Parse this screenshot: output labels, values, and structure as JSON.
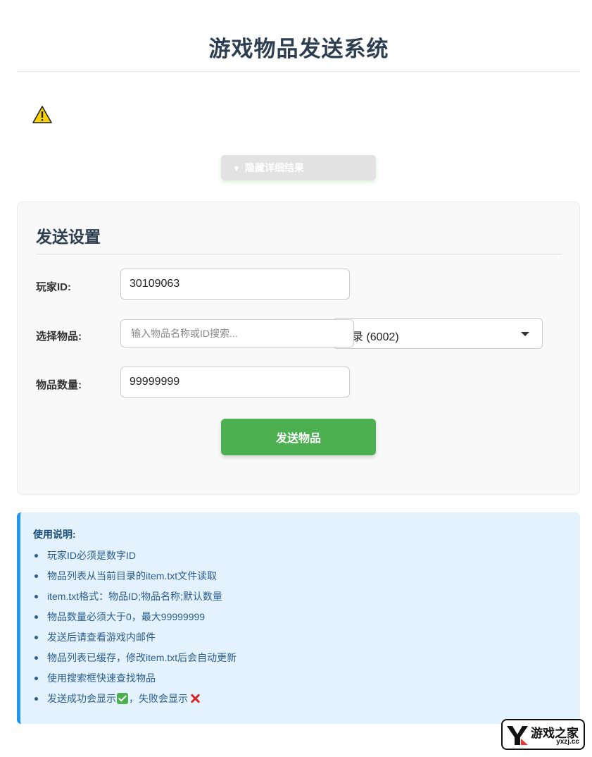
{
  "header": {
    "title": "游戏物品发送系统"
  },
  "toggle": {
    "label": "隐藏详细结果"
  },
  "settings": {
    "title": "发送设置",
    "player_id_label": "玩家ID:",
    "player_id_value": "30109063",
    "item_label": "选择物品:",
    "search_placeholder": "输入物品名称或ID搜索...",
    "selected_item": "录 (6002)",
    "quantity_label": "物品数量:",
    "quantity_value": "99999999",
    "send_label": "发送物品"
  },
  "instructions": {
    "title": "使用说明:",
    "items": [
      "玩家ID必须是数字ID",
      "物品列表从当前目录的item.txt文件读取",
      "item.txt格式：物品ID;物品名称;默认数量",
      "物品数量必须大于0，最大99999999",
      "发送后请查看游戏内邮件",
      "物品列表已缓存，修改item.txt后会自动更新",
      "使用搜索框快速查找物品"
    ],
    "last_item_prefix": "发送成功会显示",
    "last_item_middle": "，失败会显示"
  },
  "watermark": {
    "cn": "游戏之家",
    "en": "yxzj.cc"
  },
  "colors": {
    "accent_green": "#4caf50",
    "info_blue": "#2196f3",
    "title_dark": "#2c3e50"
  },
  "icons": [
    "warning-icon",
    "chevron-down-icon",
    "check-icon",
    "cross-icon"
  ]
}
